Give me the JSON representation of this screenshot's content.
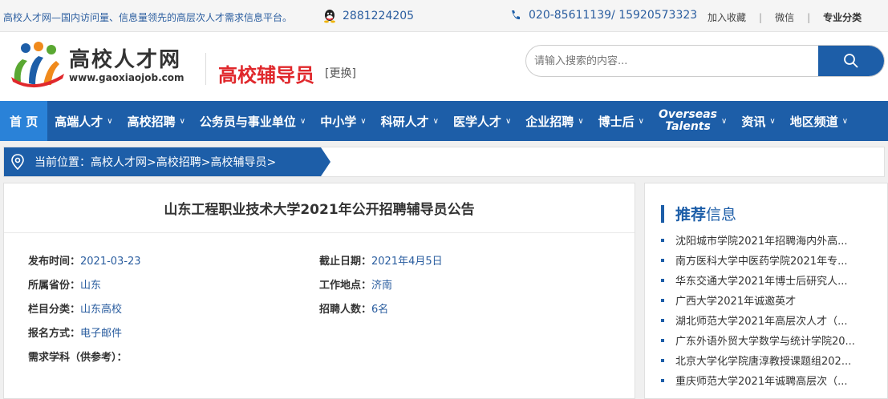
{
  "topbar": {
    "slogan": "高校人才网—国内访问量、信息量领先的高层次人才需求信息平台。",
    "qq": "2881224205",
    "phone": "020-85611139/ 15920573323",
    "links": [
      "加入收藏",
      "微信",
      "专业分类"
    ]
  },
  "header": {
    "logo_cn": "高校人才网",
    "logo_url": "www.gaoxiaojob.com",
    "channel": "高校辅导员",
    "change": "[更换]",
    "search_placeholder": "请输入搜索的内容..."
  },
  "nav": [
    {
      "label": "首 页",
      "active": true,
      "chevron": false
    },
    {
      "label": "高端人才",
      "chevron": true
    },
    {
      "label": "高校招聘",
      "chevron": true
    },
    {
      "label": "公务员与事业单位",
      "chevron": true
    },
    {
      "label": "中小学",
      "chevron": true
    },
    {
      "label": "科研人才",
      "chevron": true
    },
    {
      "label": "医学人才",
      "chevron": true
    },
    {
      "label": "企业招聘",
      "chevron": true
    },
    {
      "label": "博士后",
      "chevron": true
    },
    {
      "label": "Overseas Talents",
      "line1": "Overseas",
      "line2": "Talents",
      "chevron": true
    },
    {
      "label": "资讯",
      "chevron": true
    },
    {
      "label": "地区频道",
      "chevron": true
    }
  ],
  "breadcrumb": "当前位置：高校人才网>高校招聘>高校辅导员>",
  "article": {
    "title": "山东工程职业技术大学2021年公开招聘辅导员公告",
    "fields": {
      "publish_label": "发布时间：",
      "publish": "2021-03-23",
      "deadline_label": "截止日期：",
      "deadline": "2021年4月5日",
      "province_label": "所属省份：",
      "province": "山东",
      "location_label": "工作地点：",
      "location": "济南",
      "category_label": "栏目分类：",
      "category": "山东高校",
      "count_label": "招聘人数：",
      "count": "6名",
      "apply_label": "报名方式：",
      "apply": "电子邮件",
      "major_label": "需求学科（供参考）："
    }
  },
  "sidebar": {
    "title_strong": "推荐",
    "title_rest": "信息",
    "items": [
      "沈阳城市学院2021年招聘海内外高...",
      "南方医科大学中医药学院2021年专...",
      "华东交通大学2021年博士后研究人...",
      "广西大学2021年诚邀英才",
      "湖北师范大学2021年高层次人才（...",
      "广东外语外贸大学数学与统计学院20...",
      "北京大学化学院唐淳教授课题组202...",
      "重庆师范大学2021年诚聘高层次（..."
    ]
  },
  "colors": {
    "primary": "#1d5ea8",
    "nav_active": "#2a82d8",
    "channel": "#e0282c",
    "link": "#2a5d9f"
  }
}
